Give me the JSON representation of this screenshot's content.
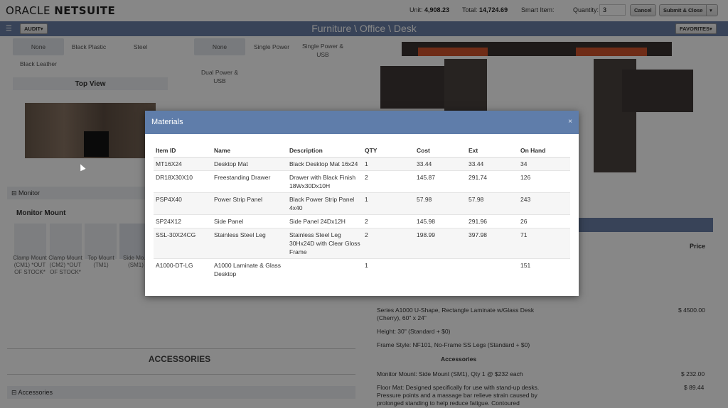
{
  "header": {
    "logo_prefix": "ORACLE ",
    "logo_brand": "NETSUITE",
    "unit_label": "Unit:",
    "unit_value": "4,908.23",
    "total_label": "Total:",
    "total_value": "14,724.69",
    "smart_item_label": "Smart Item:",
    "quantity_label": "Quantity:",
    "quantity_value": "3",
    "cancel_label": "Cancel",
    "submit_label": "Submit & Close",
    "submit_caret": "▾"
  },
  "navbar": {
    "menu_icon": "☰",
    "audit_label": "AUDIT▾",
    "breadcrumb": "Furniture \\ Office \\ Desk",
    "favorites_label": "FAVORITES▾"
  },
  "background": {
    "material_options": [
      "None",
      "Black Plastic",
      "Steel",
      "Black Leather"
    ],
    "power_options": [
      "None",
      "Single Power",
      "Single Power & USB",
      "Dual Power & USB"
    ],
    "top_view_label": "Top View",
    "monitor_section": "⊟ Monitor",
    "monitor_mount_label": "Monitor Mount",
    "mounts": [
      {
        "caption": "Clamp Mount (CM1) *OUT OF STOCK*"
      },
      {
        "caption": "Clamp Mount (CM2) *OUT OF STOCK*"
      },
      {
        "caption": "Top Mount (TM1)"
      },
      {
        "caption": "Side Mo... (SM1)"
      }
    ],
    "accessories_title": "ACCESSORIES",
    "accessories_section": "⊟ Accessories",
    "price_header": "Price",
    "series_text": "Series A1000 U-Shape, Rectangle Laminate w/Glass Desk (Cherry), 60\" x 24\"",
    "series_price": "$ 4500.00",
    "height_text": "Height: 30\" (Standard + $0)",
    "frame_text": "Frame Style: NF101, No-Frame SS Legs (Standard + $0)",
    "accessories_subhdr": "Accessories",
    "monitor_mount_text": "Monitor Mount: Side Mount (SM1), Qty 1 @ $232 each",
    "monitor_mount_price": "$ 232.00",
    "floor_mat_text": "Floor Mat: Designed specifically for use with stand-up desks. Pressure points and a massage bar relieve strain caused by prolonged standing to help reduce fatigue. Contoured",
    "floor_mat_price": "$ 89.44"
  },
  "modal": {
    "title": "Materials",
    "close_icon": "×",
    "columns": [
      "Item ID",
      "Name",
      "Description",
      "QTY",
      "Cost",
      "Ext",
      "On Hand"
    ],
    "rows": [
      [
        "MT16X24",
        "Desktop Mat",
        "Black Desktop Mat 16x24",
        "1",
        "33.44",
        "33.44",
        "34"
      ],
      [
        "DR18X30X10",
        "Freestanding Drawer",
        "Drawer with Black Finish 18Wx30Dx10H",
        "2",
        "145.87",
        "291.74",
        "126"
      ],
      [
        "PSP4X40",
        "Power Strip Panel",
        "Black Power Strip Panel 4x40",
        "1",
        "57.98",
        "57.98",
        "243"
      ],
      [
        "SP24X12",
        "Side Panel",
        "Side Panel 24Dx12H",
        "2",
        "145.98",
        "291.96",
        "26"
      ],
      [
        "SSL-30X24CG",
        "Stainless Steel Leg",
        "Stainless Steel Leg 30Hx24D with Clear Gloss Frame",
        "2",
        "198.99",
        "397.98",
        "71"
      ],
      [
        "A1000-DT-LG",
        "A1000 Laminate & Glass Desktop",
        "",
        "1",
        "",
        "",
        "151"
      ]
    ]
  },
  "colors": {
    "nav_blue": "#6a7fa6",
    "modal_header": "#5f7daa"
  }
}
